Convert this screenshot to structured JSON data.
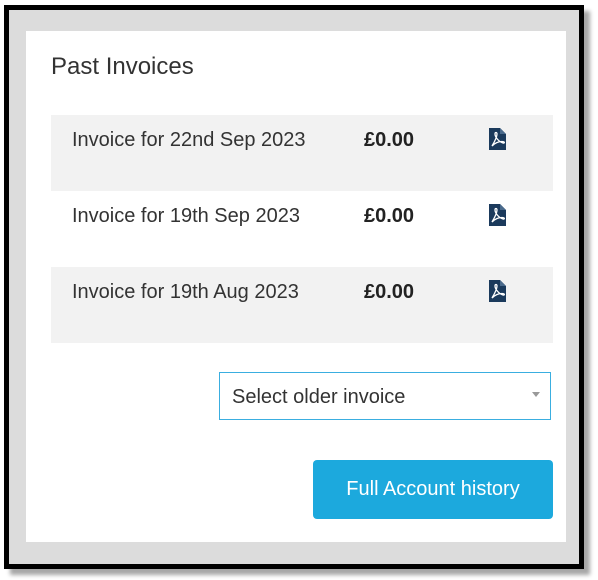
{
  "panel": {
    "title": "Past Invoices"
  },
  "invoices": [
    {
      "label": "Invoice for 22nd Sep 2023",
      "amount": "£0.00",
      "icon": "pdf-icon"
    },
    {
      "label": "Invoice for 19th Sep 2023",
      "amount": "£0.00",
      "icon": "pdf-icon"
    },
    {
      "label": "Invoice for 19th Aug 2023",
      "amount": "£0.00",
      "icon": "pdf-icon"
    }
  ],
  "older_invoice_select": {
    "selected": "Select older invoice",
    "icon": "chevron-down-icon"
  },
  "history_button": {
    "label": "Full Account history"
  },
  "colors": {
    "accent": "#1ca9dd",
    "select_border": "#3aaee0",
    "pdf_icon": "#1b3a5c",
    "row_shade": "#f2f2f2"
  }
}
